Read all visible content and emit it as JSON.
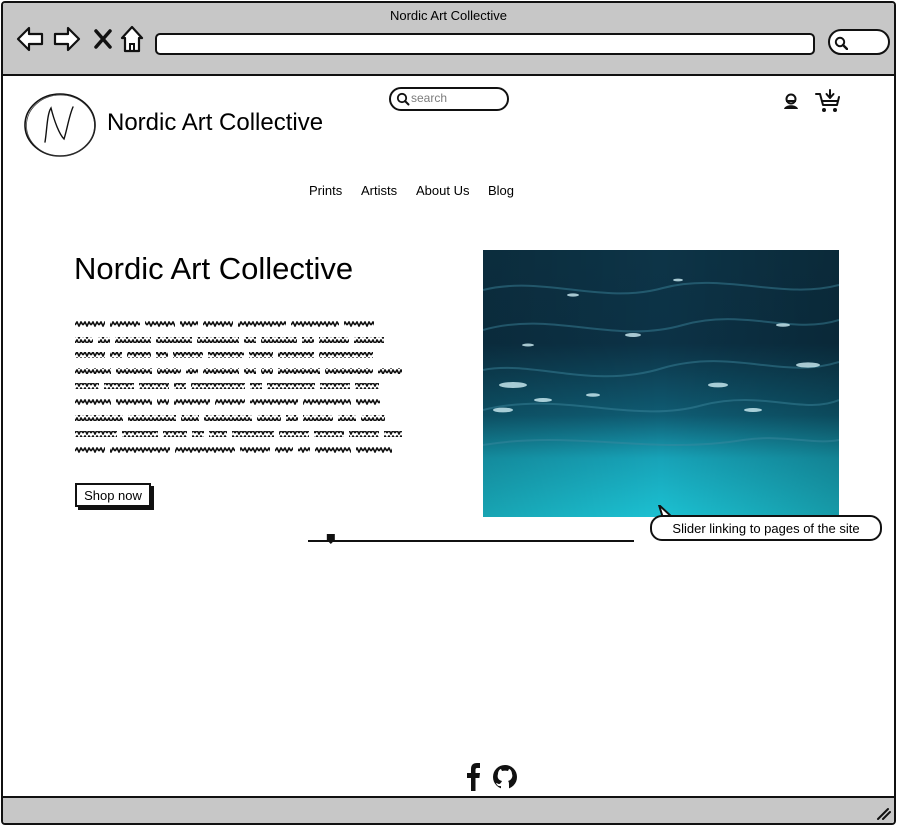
{
  "window": {
    "title": "Nordic Art Collective"
  },
  "browser": {
    "back_icon": "arrow-left-icon",
    "forward_icon": "arrow-right-icon",
    "close_icon": "close-icon",
    "home_icon": "home-icon",
    "address_value": "",
    "search_icon": "search-icon"
  },
  "header": {
    "logo_icon": "logo-n-icon",
    "brand": "Nordic Art Collective",
    "search_placeholder": "search",
    "user_icon": "user-icon",
    "cart_icon": "cart-add-icon"
  },
  "nav": {
    "items": [
      {
        "label": "Prints"
      },
      {
        "label": "Artists"
      },
      {
        "label": "About Us"
      },
      {
        "label": "Blog"
      }
    ]
  },
  "hero": {
    "title": "Nordic Art Collective",
    "body_text_lines": 9,
    "button_label": "Shop now",
    "image_alt": "underwater-sea-image"
  },
  "slider": {
    "value": 0.07
  },
  "annotation": {
    "text": "Slider linking to pages of the site"
  },
  "footer": {
    "icons": [
      "facebook-icon",
      "github-icon"
    ]
  },
  "colors": {
    "chrome_gray": "#c7c7c7",
    "sea_dark": "#0b2a3a",
    "sea_light": "#19b5c7"
  }
}
